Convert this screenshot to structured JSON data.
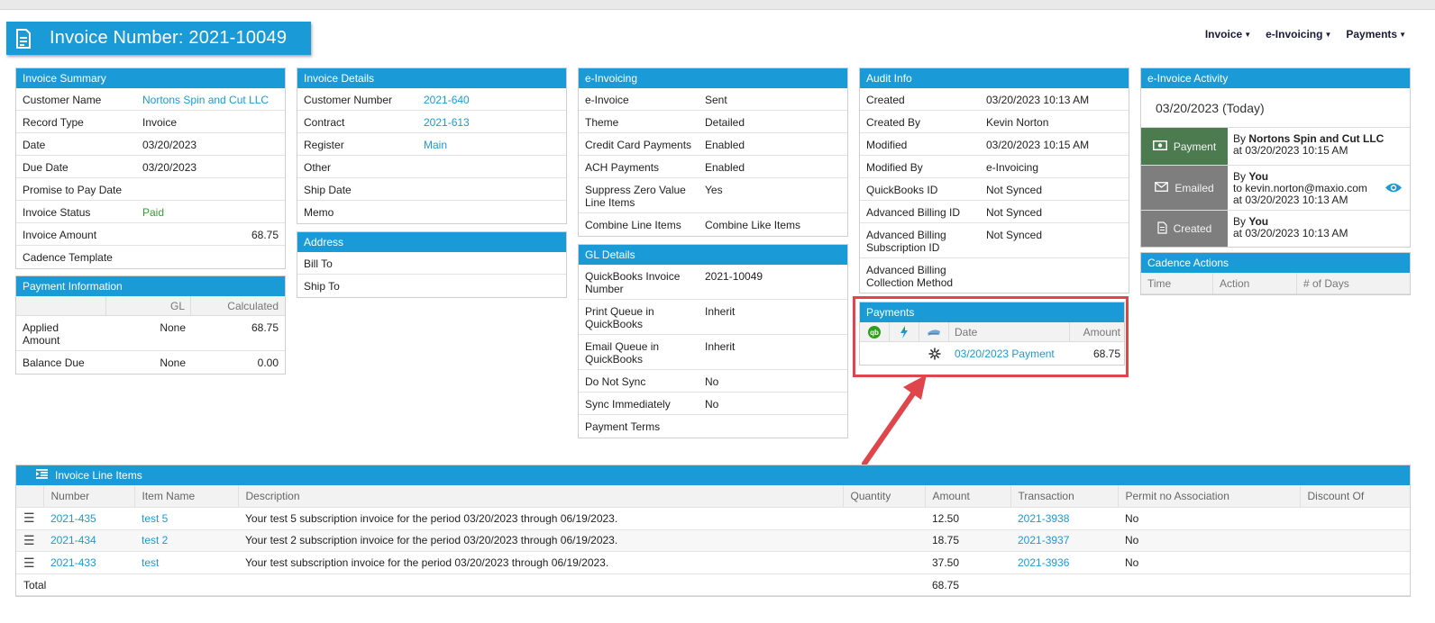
{
  "page": {
    "title": "Invoice Number: 2021-10049",
    "nav": [
      {
        "label": "Invoice"
      },
      {
        "label": "e-Invoicing"
      },
      {
        "label": "Payments"
      }
    ]
  },
  "invoice_summary": {
    "header": "Invoice Summary",
    "rows": [
      {
        "label": "Customer Name",
        "value": "Nortons Spin and Cut LLC"
      },
      {
        "label": "Record Type",
        "value": "Invoice"
      },
      {
        "label": "Date",
        "value": "03/20/2023"
      },
      {
        "label": "Due Date",
        "value": "03/20/2023"
      },
      {
        "label": "Promise to Pay Date",
        "value": ""
      },
      {
        "label": "Invoice Status",
        "value": "Paid"
      },
      {
        "label": "Invoice Amount",
        "value": "68.75"
      },
      {
        "label": "Cadence Template",
        "value": ""
      }
    ]
  },
  "payment_information": {
    "header": "Payment Information",
    "col_gl": "GL",
    "col_calculated": "Calculated",
    "rows": [
      {
        "label": "Applied Amount",
        "gl": "None",
        "calculated": "68.75"
      },
      {
        "label": "Balance Due",
        "gl": "None",
        "calculated": "0.00"
      }
    ]
  },
  "invoice_details": {
    "header": "Invoice Details",
    "rows": [
      {
        "label": "Customer Number",
        "value": "2021-640"
      },
      {
        "label": "Contract",
        "value": "2021-613"
      },
      {
        "label": "Register",
        "value": "Main"
      },
      {
        "label": "Other",
        "value": ""
      },
      {
        "label": "Ship Date",
        "value": ""
      },
      {
        "label": "Memo",
        "value": ""
      }
    ]
  },
  "address": {
    "header": "Address",
    "rows": [
      {
        "label": "Bill To"
      },
      {
        "label": "Ship To"
      }
    ]
  },
  "e_invoicing": {
    "header": "e-Invoicing",
    "rows": [
      {
        "label": "e-Invoice",
        "value": "Sent"
      },
      {
        "label": "Theme",
        "value": "Detailed"
      },
      {
        "label": "Credit Card Payments",
        "value": "Enabled"
      },
      {
        "label": "ACH Payments",
        "value": "Enabled"
      },
      {
        "label": "Suppress Zero Value Line Items",
        "value": "Yes"
      },
      {
        "label": "Combine Line Items",
        "value": "Combine Like Items"
      }
    ]
  },
  "gl_details": {
    "header": "GL Details",
    "rows": [
      {
        "label": "QuickBooks Invoice Number",
        "value": "2021-10049"
      },
      {
        "label": "Print Queue in QuickBooks",
        "value": "Inherit"
      },
      {
        "label": "Email Queue in QuickBooks",
        "value": "Inherit"
      },
      {
        "label": "Do Not Sync",
        "value": "No"
      },
      {
        "label": "Sync Immediately",
        "value": "No"
      },
      {
        "label": "Payment Terms",
        "value": ""
      }
    ]
  },
  "audit_info": {
    "header": "Audit Info",
    "rows": [
      {
        "label": "Created",
        "value": "03/20/2023 10:13 AM"
      },
      {
        "label": "Created By",
        "value": "Kevin Norton"
      },
      {
        "label": "Modified",
        "value": "03/20/2023 10:15 AM"
      },
      {
        "label": "Modified By",
        "value": "e-Invoicing"
      },
      {
        "label": "QuickBooks ID",
        "value": "Not Synced"
      },
      {
        "label": "Advanced Billing ID",
        "value": "Not Synced"
      },
      {
        "label": "Advanced Billing Subscription ID",
        "value": "Not Synced"
      },
      {
        "label": "Advanced Billing Collection Method",
        "value": ""
      }
    ]
  },
  "payments": {
    "header": "Payments",
    "col_date": "Date",
    "col_amount": "Amount",
    "rows": [
      {
        "date": "03/20/2023 Payment",
        "amount": "68.75"
      }
    ]
  },
  "einvoice_activity": {
    "header": "e-Invoice Activity",
    "date_label": "03/20/2023 (Today)",
    "items": [
      {
        "badge": "Payment",
        "by_prefix": "By",
        "by": "Nortons Spin and Cut LLC",
        "line2": "",
        "at": "at 03/20/2023 10:15 AM"
      },
      {
        "badge": "Emailed",
        "by_prefix": "By",
        "by": "You",
        "line2": "to kevin.norton@maxio.com",
        "at": "at 03/20/2023 10:13 AM"
      },
      {
        "badge": "Created",
        "by_prefix": "By",
        "by": "You",
        "line2": "",
        "at": "at 03/20/2023 10:13 AM"
      }
    ]
  },
  "cadence_actions": {
    "header": "Cadence Actions",
    "cols": [
      "Time",
      "Action",
      "# of Days"
    ]
  },
  "line_items": {
    "header": "Invoice Line Items",
    "cols": [
      "Number",
      "Item Name",
      "Description",
      "Quantity",
      "Amount",
      "Transaction",
      "Permit no Association",
      "Discount Of"
    ],
    "rows": [
      {
        "number": "2021-435",
        "item": "test 5",
        "description": "Your test 5 subscription invoice for the period 03/20/2023 through 06/19/2023.",
        "quantity": "",
        "amount": "12.50",
        "transaction": "2021-3938",
        "permit": "No",
        "discount": ""
      },
      {
        "number": "2021-434",
        "item": "test 2",
        "description": "Your test 2 subscription invoice for the period 03/20/2023 through 06/19/2023.",
        "quantity": "",
        "amount": "18.75",
        "transaction": "2021-3937",
        "permit": "No",
        "discount": ""
      },
      {
        "number": "2021-433",
        "item": "test",
        "description": "Your test subscription invoice for the period 03/20/2023 through 06/19/2023.",
        "quantity": "",
        "amount": "37.50",
        "transaction": "2021-3936",
        "permit": "No",
        "discount": ""
      }
    ],
    "total_label": "Total",
    "total_amount": "68.75"
  },
  "colors": {
    "header_blue": "#1a9bd7",
    "link_blue": "#1a9bd7",
    "paid_green": "#3a9a35",
    "highlight_red": "#e0454b",
    "payment_badge": "#4d7b50",
    "neutral_badge": "#7e7e7e"
  },
  "icons": {
    "title": "document-icon",
    "payments_cols": [
      "quickbooks-icon",
      "bolt-icon",
      "card-icon"
    ],
    "payment_row": "spinner-icon",
    "activity": [
      "cash-icon",
      "envelope-icon",
      "document-icon"
    ],
    "view": "eye-icon",
    "line_items": "list-indent-icon",
    "row_menu": "hamburger-icon"
  }
}
